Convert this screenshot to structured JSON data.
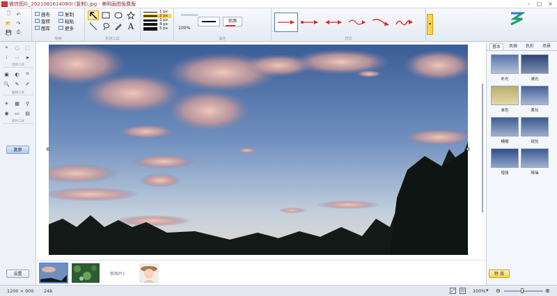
{
  "window": {
    "title": "微信图片_2021081614080I (复制).jpg - 美明画图免费版",
    "min": "–",
    "max": "□",
    "close": "×"
  },
  "ribbon": {
    "clipboard": {
      "canvas": "画布",
      "rotate": "旋转",
      "gallery": "图库",
      "copy": "复制",
      "paste": "粘贴",
      "more": "更多",
      "label": "常用"
    },
    "shapes": {
      "label": "形状工具"
    },
    "line_widths": [
      "1 px",
      "2 px",
      "3 px",
      "4 px",
      "5 px"
    ],
    "zoom": "100%",
    "outline": "轮廓",
    "styles_label": "样式",
    "width_label": "属性"
  },
  "left": {
    "select_section": "选择工具",
    "edit_section": "编辑工具",
    "color_section": "颜色工具",
    "restore_label": "复原",
    "settings_label": "设置"
  },
  "thumbs": {
    "new_label": "新图片1"
  },
  "right": {
    "tabs": [
      "基本",
      "风格",
      "色彩",
      "场景"
    ],
    "effects": [
      "补光",
      "减光",
      "单色",
      "柔化",
      "模糊",
      "锐化",
      "增强",
      "降噪"
    ],
    "fx_button": "特 效"
  },
  "status": {
    "dimensions": "1200 × 900",
    "depth": "24b",
    "zoom": "100%"
  },
  "colors": {
    "accent": "#e0262a",
    "ribbon_sel": "#ffd34d"
  }
}
